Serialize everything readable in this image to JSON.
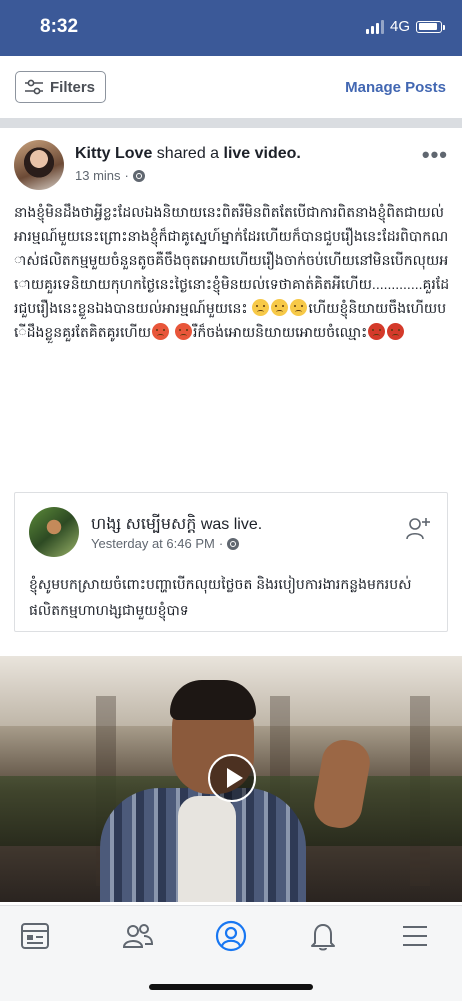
{
  "status_bar": {
    "time": "8:32",
    "network": "4G",
    "icons": [
      "signal-icon",
      "battery-icon"
    ]
  },
  "toolbar": {
    "filters_label": "Filters",
    "manage_posts_label": "Manage Posts"
  },
  "post": {
    "author": "Kitty Love",
    "action_prefix": " shared a ",
    "action_object": "live video.",
    "time": "13 mins",
    "privacy_icon": "globe-icon",
    "more_icon": "more-dots-icon",
    "text_part1": "នាងខ្ញុំមិនដឹងថាអ្វីខ្លះដែលឯងនិយាយនេះពិតរឺមិនពិតតែបើជាការពិតនាងខ្ញុំពិតជាយល់អារម្មណ៍មួយនេះព្រោះនាងខ្ញុំក៏ជាគូស្នេហ៍ម្នាក់ដែរហើយក៏បានជួបរឿងនេះដែរពិបាកណាស់ផលិតកម្មមួយចំនួនតូចគឺចឹងចុតអោយហើយរឿងចាក់ចប់ហើយនៅមិនបើកលុយអោយគួរទេនិយាយកុហកថ្ងៃនេះថ្ងៃនោះខ្ញុំមិនយល់ទេថាគាត់គិតអីហើយ.............គួរដែរជួបរឿងនេះខ្លួនឯងបានយល់អារម្មណ៍មួយនេះ",
    "text_part2": "ហើយខ្ញុំនិយាយចឹងហើយបើដឹងខ្លួនគួរតែគិតគូរហើយ",
    "text_part3": "រឺក៏ចង់អោយនិយាយអោយចំឈ្មោះ",
    "emoji_icons": [
      "worried-face-icon",
      "angry-face-icon",
      "swearing-face-icon"
    ]
  },
  "shared": {
    "author": "ហង្ស សម្បើមសក្តិ",
    "status": " was live.",
    "time": "Yesterday at 6:46 PM",
    "text": "ខ្ញុំសូមបកស្រាយចំពោះបញ្ហាបើកលុយថ្លៃចត និងរបៀបការងារកន្លងមករបស់ផលិតកម្មហាហង្សជាមួយខ្ញុំបាទ",
    "add_friend_icon": "add-friend-icon"
  },
  "video": {
    "play_icon": "play-icon"
  },
  "tabbar": {
    "items": [
      "news-feed-icon",
      "friends-icon",
      "profile-icon",
      "notifications-icon",
      "menu-icon"
    ]
  },
  "colors": {
    "brand": "#3b5998",
    "link": "#4267b2",
    "active_tab": "#1877f2"
  }
}
